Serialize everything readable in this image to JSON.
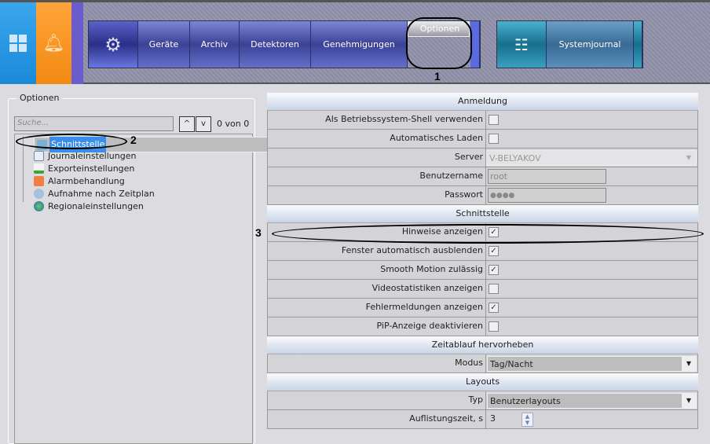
{
  "topbar": {
    "nav": [
      "Geräte",
      "Archiv",
      "Detektoren",
      "Genehmigungen",
      "Optionen"
    ],
    "systemjournal": "Systemjournal"
  },
  "annotations": [
    "1",
    "2",
    "3"
  ],
  "left": {
    "legend": "Optionen",
    "search_placeholder": "Suche...",
    "counter": "0 von 0",
    "up": "^",
    "down": "v",
    "tree": [
      "Schnittstelle",
      "Journaleinstellungen",
      "Exporteinstellungen",
      "Alarmbehandlung",
      "Aufnahme nach Zeitplan",
      "Regionaleinstellungen"
    ]
  },
  "grid": {
    "anmeldung": {
      "title": "Anmeldung",
      "shell": "Als Betriebssystem-Shell verwenden",
      "autoload": "Automatisches Laden",
      "server_label": "Server",
      "server": "V-BELYAKOV",
      "user_label": "Benutzername",
      "user": "root",
      "pass_label": "Passwort",
      "pass": "●●●●"
    },
    "schnittstelle": {
      "title": "Schnittstelle",
      "rows": [
        {
          "label": "Hinweise anzeigen",
          "checked": true
        },
        {
          "label": "Fenster automatisch ausblenden",
          "checked": true
        },
        {
          "label": "Smooth Motion zulässig",
          "checked": true
        },
        {
          "label": "Videostatistiken anzeigen",
          "checked": false
        },
        {
          "label": "Fehlermeldungen anzeigen",
          "checked": true
        },
        {
          "label": "PiP-Anzeige deaktivieren",
          "checked": false
        }
      ]
    },
    "zeit": {
      "title": "Zeitablauf hervorheben",
      "mode_label": "Modus",
      "mode": "Tag/Nacht"
    },
    "layouts": {
      "title": "Layouts",
      "type_label": "Typ",
      "type": "Benutzerlayouts",
      "time_label": "Auflistungszeit, s",
      "time": "3"
    }
  }
}
